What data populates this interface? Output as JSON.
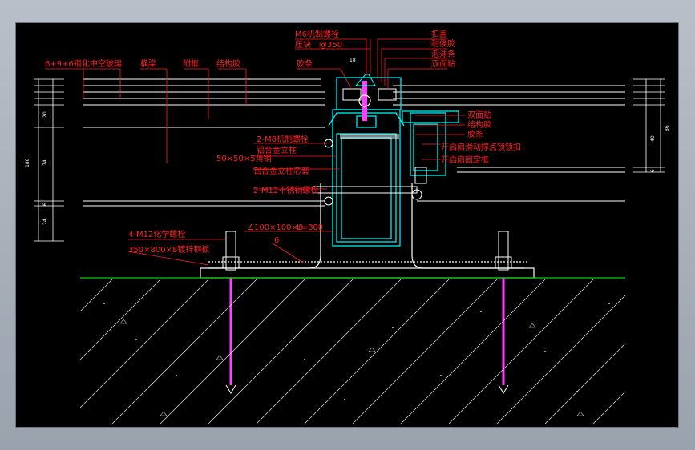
{
  "drawing": {
    "labels": {
      "glass": "6+9+6钢化中空玻璃",
      "beam": "横梁",
      "subframe": "附框",
      "structural_sealant": "结构胶",
      "m6_bolt": "M6机制螺栓",
      "pressure_plate": "压块",
      "pressure_plate_spacing": "@350",
      "cover_strip": "扣盖",
      "rubber_strip": "胶条",
      "weather_sealant": "耐候胶",
      "foam_rod": "泡沫条",
      "double_sided_tape": "双面贴",
      "double_tape_2": "双面贴",
      "structural_sealant_2": "结构胶",
      "rubber_strip_2": "胶条",
      "window_mullion_lock": "开启扇滑动撑点锁锁扣",
      "window_fixing_frame": "开启扇固定框",
      "m8_bolts": "2-M8机制螺栓",
      "angle_steel": "50×50×5角钢",
      "aluminum_mullion": "铝合金立柱",
      "mullion_core": "铝合金立柱芯套",
      "m12_stainless_bolts": "2-M12不锈钢螺栓",
      "chemical_anchors": "4-M12化学螺栓",
      "embedded_plate": "350×800×8镀锌钢板",
      "angle_spec": "∠100×100×8",
      "angle_length": "L=800",
      "weld": "6"
    },
    "dimensions": {
      "pressure_offset": "18",
      "left_20": "20",
      "left_180": "180",
      "left_74": "74",
      "left_6": "6",
      "left_24": "24",
      "right_40": "40",
      "right_86": "86",
      "right_6": "6"
    },
    "colors": {
      "background": "#000000",
      "annotation": "#ff2020",
      "profile": "#00ffff",
      "steel": "#ffffff",
      "ground": "#00d000",
      "hatch": "#ffffff",
      "bolt": "#ff40ff"
    }
  }
}
